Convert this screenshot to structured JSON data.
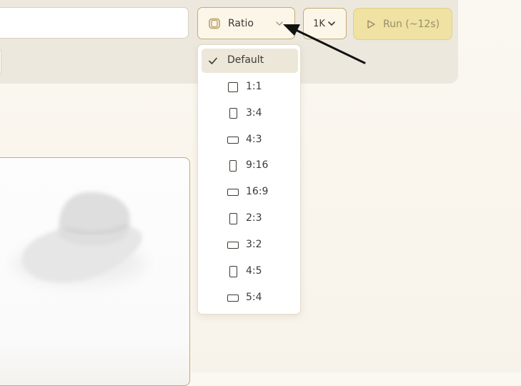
{
  "toolbar": {
    "ratio_label": "Ratio",
    "resolution_label": "1K",
    "run_label": "Run (~12s)"
  },
  "ratio_menu": {
    "selected": "Default",
    "items": [
      {
        "label": "Default",
        "shape": "check-icon"
      },
      {
        "label": "1:1",
        "shape": "square-icon"
      },
      {
        "label": "3:4",
        "shape": "portrait-icon"
      },
      {
        "label": "4:3",
        "shape": "landscape-icon"
      },
      {
        "label": "9:16",
        "shape": "portrait-icon"
      },
      {
        "label": "16:9",
        "shape": "landscape-icon"
      },
      {
        "label": "2:3",
        "shape": "portrait-icon"
      },
      {
        "label": "3:2",
        "shape": "landscape-icon"
      },
      {
        "label": "4:5",
        "shape": "portrait-icon"
      },
      {
        "label": "5:4",
        "shape": "landscape-icon"
      }
    ]
  },
  "colors": {
    "accent_border": "#c4aa78",
    "run_button": "#efe2a2",
    "panel": "#ede8de",
    "selected_item": "#ede7da"
  }
}
